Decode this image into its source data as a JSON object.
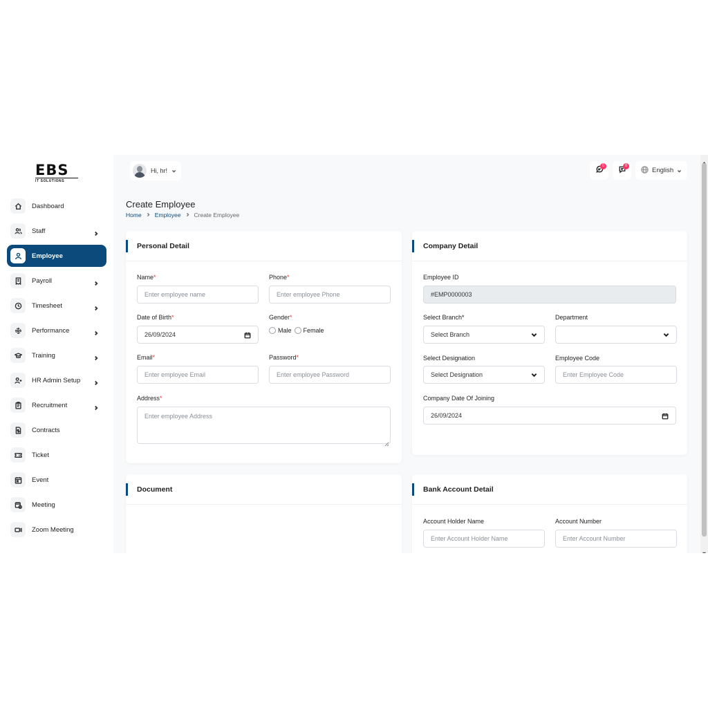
{
  "brand": {
    "logo_main": "EBS",
    "logo_sub": "IT SOLUTIONS"
  },
  "header": {
    "greeting": "Hi, hr!",
    "chat_badge": "0",
    "notif_badge": "0",
    "language": "English"
  },
  "sidebar": {
    "items": [
      {
        "label": "Dashboard",
        "icon": "home-icon",
        "chevron": false,
        "active": false
      },
      {
        "label": "Staff",
        "icon": "users-icon",
        "chevron": true,
        "active": false
      },
      {
        "label": "Employee",
        "icon": "user-icon",
        "chevron": false,
        "active": true
      },
      {
        "label": "Payroll",
        "icon": "receipt-icon",
        "chevron": true,
        "active": false
      },
      {
        "label": "Timesheet",
        "icon": "clock-icon",
        "chevron": true,
        "active": false
      },
      {
        "label": "Performance",
        "icon": "target-icon",
        "chevron": true,
        "active": false
      },
      {
        "label": "Training",
        "icon": "graduation-cap-icon",
        "chevron": true,
        "active": false
      },
      {
        "label": "HR Admin Setup",
        "icon": "user-plus-icon",
        "chevron": true,
        "active": false
      },
      {
        "label": "Recruitment",
        "icon": "clipboard-icon",
        "chevron": true,
        "active": false
      },
      {
        "label": "Contracts",
        "icon": "file-dollar-icon",
        "chevron": false,
        "active": false
      },
      {
        "label": "Ticket",
        "icon": "ticket-icon",
        "chevron": false,
        "active": false
      },
      {
        "label": "Event",
        "icon": "calendar-event-icon",
        "chevron": false,
        "active": false
      },
      {
        "label": "Meeting",
        "icon": "calendar-time-icon",
        "chevron": false,
        "active": false
      },
      {
        "label": "Zoom Meeting",
        "icon": "video-icon",
        "chevron": false,
        "active": false
      }
    ]
  },
  "page": {
    "title": "Create Employee",
    "breadcrumb": [
      "Home",
      "Employee",
      "Create Employee"
    ]
  },
  "personal": {
    "title": "Personal Detail",
    "name_label": "Name",
    "name_placeholder": "Enter employee name",
    "phone_label": "Phone",
    "phone_placeholder": "Enter employee Phone",
    "dob_label": "Date of Birth",
    "dob_value": "26/09/2024",
    "gender_label": "Gender",
    "gender_male": "Male",
    "gender_female": "Female",
    "email_label": "Email",
    "email_placeholder": "Enter employee Email",
    "password_label": "Password",
    "password_placeholder": "Enter employee Password",
    "address_label": "Address",
    "address_placeholder": "Enter employee Address",
    "required_mark": "*"
  },
  "company": {
    "title": "Company Detail",
    "employee_id_label": "Employee ID",
    "employee_id_value": "#EMP0000003",
    "branch_label": "Select Branch*",
    "branch_value": "Select Branch",
    "department_label": "Department",
    "department_value": "",
    "designation_label": "Select Designation",
    "designation_value": "Select Designation",
    "code_label": "Employee Code",
    "code_placeholder": "Enter Employee Code",
    "doj_label": "Company Date Of Joining",
    "doj_value": "26/09/2024"
  },
  "document": {
    "title": "Document"
  },
  "bank": {
    "title": "Bank Account Detail",
    "holder_label": "Account Holder Name",
    "holder_placeholder": "Enter Account Holder Name",
    "number_label": "Account Number",
    "number_placeholder": "Enter Account Number"
  }
}
